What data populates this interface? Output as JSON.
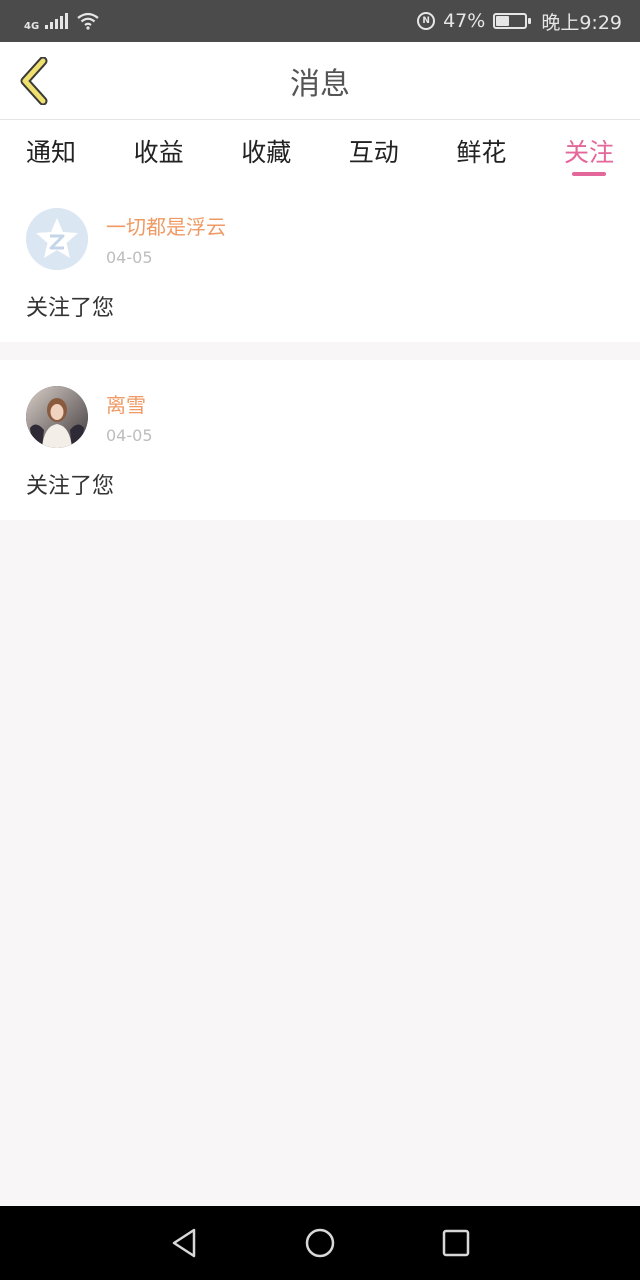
{
  "status_bar": {
    "network": "4G",
    "battery": "47%",
    "time": "晚上9:29",
    "battery_level": 0.47
  },
  "header": {
    "title": "消息"
  },
  "tabs": [
    {
      "label": "通知",
      "active": false
    },
    {
      "label": "收益",
      "active": false
    },
    {
      "label": "收藏",
      "active": false
    },
    {
      "label": "互动",
      "active": false
    },
    {
      "label": "鲜花",
      "active": false
    },
    {
      "label": "关注",
      "active": true
    }
  ],
  "messages": [
    {
      "name": "一切都是浮云",
      "date": "04-05",
      "text": "关注了您",
      "avatar": "default-star-avatar"
    },
    {
      "name": "离雪",
      "date": "04-05",
      "text": "关注了您",
      "avatar": "photo-avatar"
    }
  ],
  "colors": {
    "accent": "#e3679a",
    "name": "#ef9a64",
    "back_arrow": "#f0e070",
    "status_bg": "#4b4b4b"
  },
  "icons": {
    "back": "chevron-left-icon",
    "nav_back": "triangle-back-icon",
    "nav_home": "circle-home-icon",
    "nav_recent": "square-recent-icon"
  }
}
